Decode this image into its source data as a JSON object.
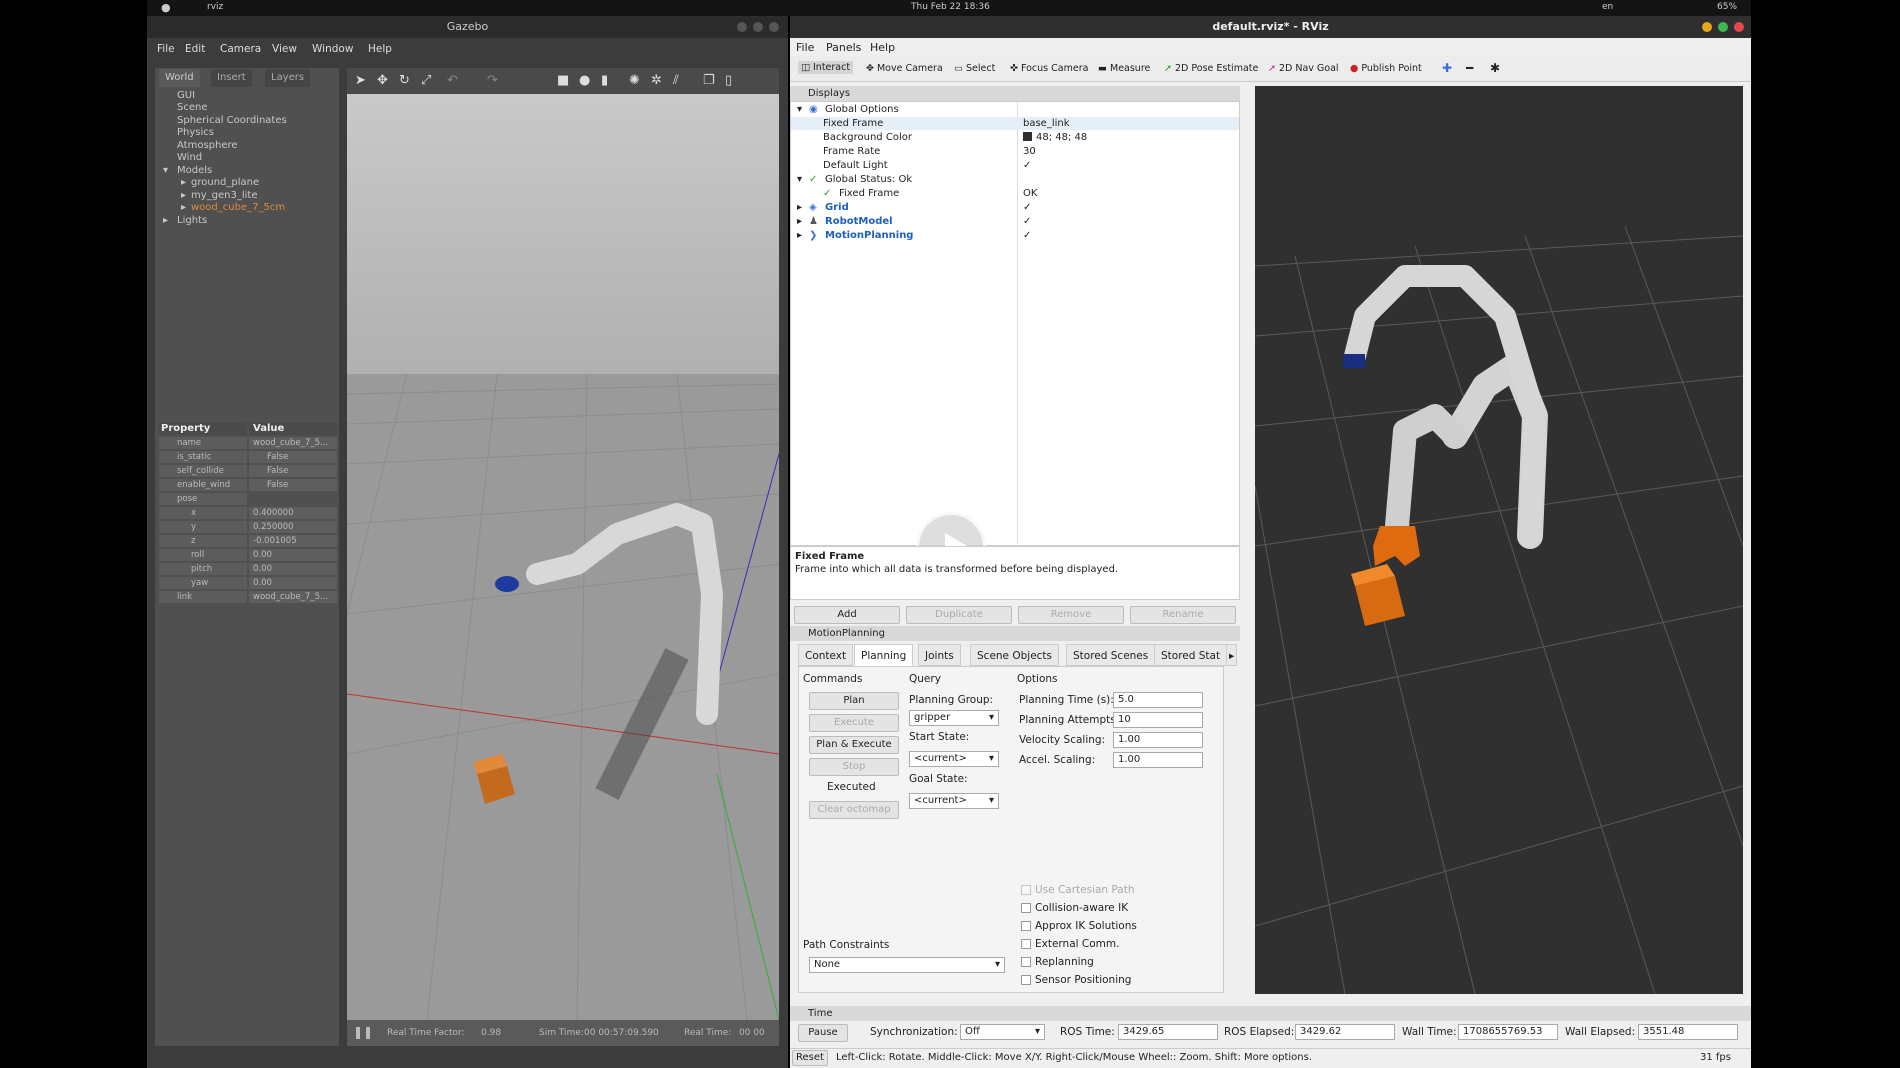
{
  "topbar": {
    "app": "rviz",
    "datetime": "Thu Feb 22  18:36",
    "lang": "en",
    "battery": "65%"
  },
  "gazebo": {
    "title": "Gazebo",
    "menu": [
      "File",
      "Edit",
      "Camera",
      "View",
      "Window",
      "Help"
    ],
    "tabs": [
      "World",
      "Insert",
      "Layers"
    ],
    "tree": [
      "GUI",
      "Scene",
      "Spherical Coordinates",
      "Physics",
      "Atmosphere",
      "Wind",
      "Models",
      "ground_plane",
      "my_gen3_lite",
      "wood_cube_7_5cm",
      "Lights"
    ],
    "props_header": {
      "property": "Property",
      "value": "Value"
    },
    "props": [
      {
        "k": "name",
        "v": "wood_cube_7_5..."
      },
      {
        "k": "is_static",
        "v": "False"
      },
      {
        "k": "self_collide",
        "v": "False"
      },
      {
        "k": "enable_wind",
        "v": "False"
      },
      {
        "k": "pose",
        "v": ""
      },
      {
        "k": "x",
        "v": "0.400000"
      },
      {
        "k": "y",
        "v": "0.250000"
      },
      {
        "k": "z",
        "v": "-0.001005"
      },
      {
        "k": "roll",
        "v": "0.00"
      },
      {
        "k": "pitch",
        "v": "0.00"
      },
      {
        "k": "yaw",
        "v": "0.00"
      },
      {
        "k": "link",
        "v": "wood_cube_7_5..."
      }
    ],
    "bottom": {
      "rtf_label": "Real Time Factor:",
      "rtf": "0.98",
      "sim_label": "Sim Time:",
      "sim": "00 00:57:09.590",
      "real_label": "Real Time:",
      "real": "00 00"
    }
  },
  "rviz": {
    "title": "default.rviz* - RViz",
    "menu": [
      "File",
      "Panels",
      "Help"
    ],
    "tools": [
      "Interact",
      "Move Camera",
      "Select",
      "Focus Camera",
      "Measure",
      "2D Pose Estimate",
      "2D Nav Goal",
      "Publish Point"
    ],
    "displays_title": "Displays",
    "displays": {
      "global_options": "Global Options",
      "fixed_frame_label": "Fixed Frame",
      "fixed_frame": "base_link",
      "bg_label": "Background Color",
      "bg": "48; 48; 48",
      "rate_label": "Frame Rate",
      "rate": "30",
      "light_label": "Default Light",
      "status_label": "Global Status: Ok",
      "status_ff": "Fixed Frame",
      "status_ff_val": "OK",
      "grid": "Grid",
      "robot": "RobotModel",
      "mp": "MotionPlanning"
    },
    "desc_title": "Fixed Frame",
    "desc_text": "Frame into which all data is transformed before being displayed.",
    "disp_buttons": [
      "Add",
      "Duplicate",
      "Remove",
      "Rename"
    ],
    "mp_title": "MotionPlanning",
    "mp_tabs": [
      "Context",
      "Planning",
      "Joints",
      "Scene Objects",
      "Stored Scenes",
      "Stored Stat"
    ],
    "commands_label": "Commands",
    "query_label": "Query",
    "options_label": "Options",
    "commands": [
      "Plan",
      "Execute",
      "Plan & Execute",
      "Stop",
      "Executed",
      "Clear octomap"
    ],
    "planning_group_label": "Planning Group:",
    "planning_group": "gripper",
    "start_state_label": "Start State:",
    "start_state": "<current>",
    "goal_state_label": "Goal State:",
    "goal_state": "<current>",
    "opt_time_label": "Planning Time (s):",
    "opt_time": "5.0",
    "opt_attempts_label": "Planning Attempts:",
    "opt_attempts": "10",
    "opt_vel_label": "Velocity Scaling:",
    "opt_vel": "1.00",
    "opt_acc_label": "Accel. Scaling:",
    "opt_acc": "1.00",
    "checks": [
      "Use Cartesian Path",
      "Collision-aware IK",
      "Approx IK Solutions",
      "External Comm.",
      "Replanning",
      "Sensor Positioning"
    ],
    "path_label": "Path Constraints",
    "path_value": "None",
    "time_title": "Time",
    "pause": "Pause",
    "sync_label": "Synchronization:",
    "sync": "Off",
    "ros_time_label": "ROS Time:",
    "ros_time": "3429.65",
    "ros_elapsed_label": "ROS Elapsed:",
    "ros_elapsed": "3429.62",
    "wall_time_label": "Wall Time:",
    "wall_time": "1708655769.53",
    "wall_elapsed_label": "Wall Elapsed:",
    "wall_elapsed": "3551.48",
    "reset": "Reset",
    "hint": "Left-Click: Rotate.  Middle-Click: Move X/Y.  Right-Click/Mouse Wheel:: Zoom.  Shift: More options.",
    "fps": "31 fps"
  }
}
